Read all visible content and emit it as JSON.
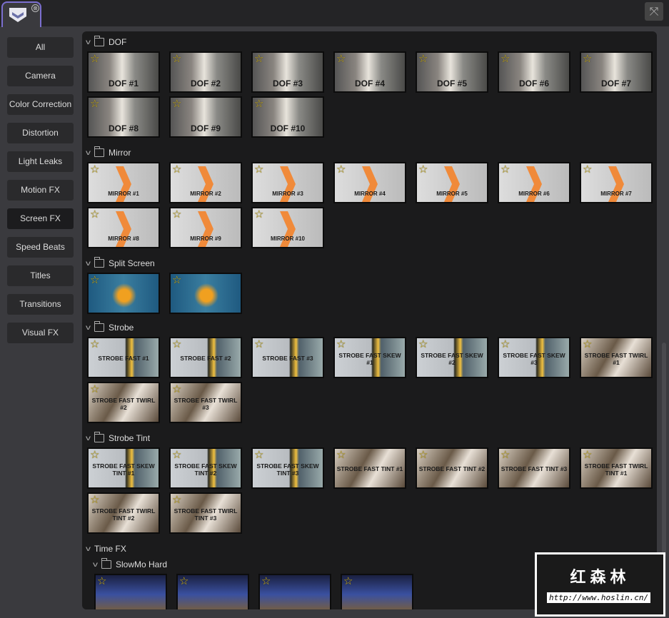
{
  "sidebar": {
    "items": [
      {
        "label": "All"
      },
      {
        "label": "Camera"
      },
      {
        "label": "Color Correction"
      },
      {
        "label": "Distortion"
      },
      {
        "label": "Light Leaks"
      },
      {
        "label": "Motion FX"
      },
      {
        "label": "Screen FX",
        "active": true
      },
      {
        "label": "Speed Beats"
      },
      {
        "label": "Titles"
      },
      {
        "label": "Transitions"
      },
      {
        "label": "Visual FX"
      }
    ]
  },
  "tab": {
    "close": "⊗"
  },
  "sections": [
    {
      "title": "DOF",
      "style": "dof",
      "items": [
        "DOF #1",
        "DOF #2",
        "DOF #3",
        "DOF #4",
        "DOF #5",
        "DOF #6",
        "DOF #7",
        "DOF #8",
        "DOF #9",
        "DOF #10"
      ]
    },
    {
      "title": "Mirror",
      "style": "mirror",
      "items": [
        "MIRROR #1",
        "MIRROR #2",
        "MIRROR #3",
        "MIRROR #4",
        "MIRROR #5",
        "MIRROR #6",
        "MIRROR #7",
        "MIRROR #8",
        "MIRROR #9",
        "MIRROR #10"
      ]
    },
    {
      "title": "Split Screen",
      "style": "split",
      "items": [
        "",
        ""
      ]
    },
    {
      "title": "Strobe",
      "style": "strobe",
      "items": [
        "STROBE FAST #1",
        "STROBE FAST #2",
        "STROBE FAST #3",
        "STROBE FAST SKEW #1",
        "STROBE FAST SKEW #2",
        "STROBE FAST SKEW #3",
        "STROBE FAST TWIRL #1",
        "STROBE FAST TWIRL #2",
        "STROBE FAST TWIRL #3"
      ]
    },
    {
      "title": "Strobe Tint",
      "style": "strobe",
      "items": [
        "STROBE FAST SKEW TINT #1",
        "STROBE FAST SKEW TINT #2",
        "STROBE FAST SKEW TINT #3",
        "STROBE FAST TINT #1",
        "STROBE FAST TINT #2",
        "STROBE FAST TINT #3",
        "STROBE FAST TWIRL TINT #1",
        "STROBE FAST TWIRL TINT #2",
        "STROBE FAST TWIRL TINT #3"
      ]
    },
    {
      "title": "Time FX",
      "style": "none",
      "items": []
    },
    {
      "title": "SlowMo Hard",
      "style": "slowmo",
      "indent": true,
      "items": [
        "",
        "",
        "",
        ""
      ]
    }
  ],
  "watermark": {
    "title": "红森林",
    "url": "http://www.hoslin.cn/"
  }
}
